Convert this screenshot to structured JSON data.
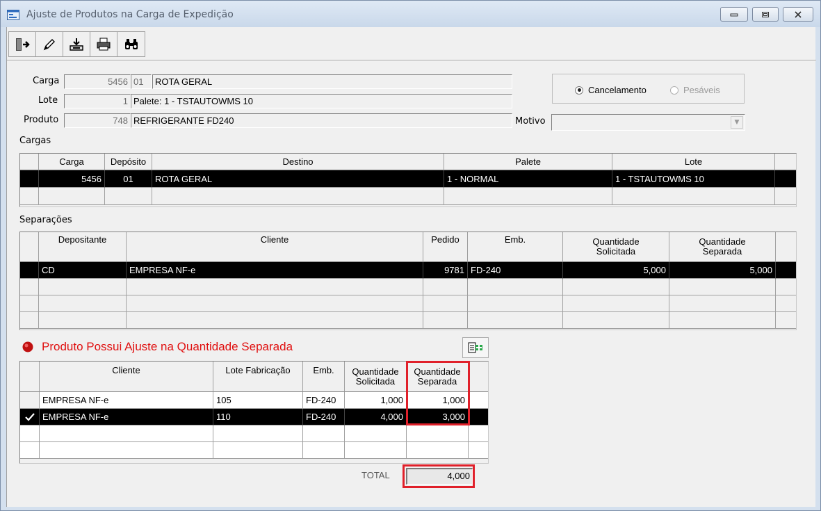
{
  "window": {
    "title": "Ajuste de Produtos na Carga de Expedição",
    "minimize_icon": "minimize-icon",
    "maximize_icon": "restore-icon",
    "close_icon": "close-icon"
  },
  "toolbar": {
    "buttons": [
      "exit-icon",
      "edit-pencil-icon",
      "import-tray-icon",
      "print-icon",
      "binoculars-search-icon"
    ]
  },
  "form": {
    "carga_label": "Carga",
    "carga_number": "5456",
    "carga_deposit": "01",
    "carga_desc": "ROTA GERAL",
    "lote_label": "Lote",
    "lote_number": "1",
    "lote_desc": "Palete: 1 - TSTAUTOWMS 10",
    "produto_label": "Produto",
    "produto_number": "748",
    "produto_desc": "REFRIGERANTE FD240",
    "motivo_label": "Motivo",
    "motivo_value": "",
    "option_cancelamento": "Cancelamento",
    "option_pesaveis": "Pesáveis",
    "selected_option": "Cancelamento"
  },
  "cargas": {
    "section_label": "Cargas",
    "columns": [
      "Carga",
      "Depósito",
      "Destino",
      "Palete",
      "Lote"
    ],
    "rows": [
      {
        "carga": "5456",
        "deposito": "01",
        "destino": "ROTA GERAL",
        "palete": "1 - NORMAL",
        "lote": "1 - TSTAUTOWMS 10",
        "selected": true
      }
    ]
  },
  "separacoes": {
    "section_label": "Separações",
    "columns": [
      "Depositante",
      "Cliente",
      "Pedido",
      "Emb.",
      "Quantidade\nSolicitada",
      "Quantidade\nSeparada"
    ],
    "rows": [
      {
        "depositante": "CD",
        "cliente": "EMPRESA NF-e",
        "pedido": "9781",
        "emb": "FD-240",
        "qtd_solicitada": "5,000",
        "qtd_separada": "5,000",
        "selected": true
      }
    ]
  },
  "ajuste": {
    "warning": "Produto Possui Ajuste na Quantidade Separada",
    "warning_icon": "red-alert-icon",
    "add_icon": "add-row-icon",
    "columns": [
      "Cliente",
      "Lote Fabricação",
      "Emb.",
      "Quantidade\nSolicitada",
      "Quantidade\nSeparada"
    ],
    "rows": [
      {
        "cliente": "EMPRESA NF-e",
        "lote": "105",
        "emb": "FD-240",
        "qtd_solicitada": "1,000",
        "qtd_separada": "1,000",
        "selected": false
      },
      {
        "cliente": "EMPRESA NF-e",
        "lote": "110",
        "emb": "FD-240",
        "qtd_solicitada": "4,000",
        "qtd_separada": "3,000",
        "selected": true
      }
    ],
    "total_label": "TOTAL",
    "total_value": "4,000",
    "highlight_color": "#e0202a"
  }
}
